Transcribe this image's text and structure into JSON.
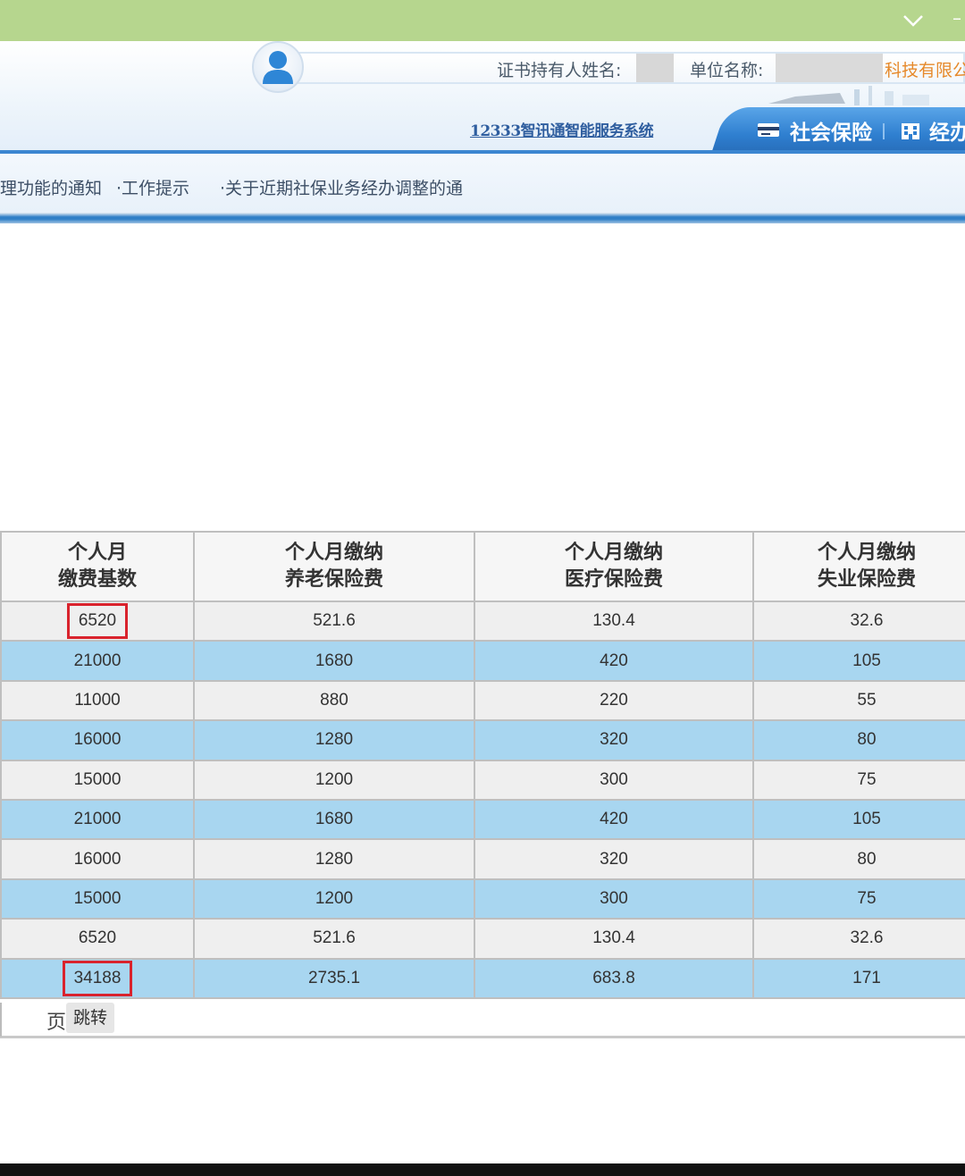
{
  "header": {
    "holder_label": "证书持有人姓名:",
    "unit_label": "单位名称:",
    "unit_name": "科技有限公",
    "system_name": "12333智讯通智能服务系统",
    "tabs": [
      "社会保险",
      "经办"
    ]
  },
  "notices": [
    "理功能的通知",
    "·工作提示",
    "·关于近期社保业务经办调整的通"
  ],
  "table": {
    "columns": [
      "个人月\n缴费基数",
      "个人月缴纳\n养老保险费",
      "个人月缴纳\n医疗保险费",
      "个人月缴纳\n失业保险费"
    ],
    "rows": [
      [
        "6520",
        "521.6",
        "130.4",
        "32.6"
      ],
      [
        "21000",
        "1680",
        "420",
        "105"
      ],
      [
        "11000",
        "880",
        "220",
        "55"
      ],
      [
        "16000",
        "1280",
        "320",
        "80"
      ],
      [
        "15000",
        "1200",
        "300",
        "75"
      ],
      [
        "21000",
        "1680",
        "420",
        "105"
      ],
      [
        "16000",
        "1280",
        "320",
        "80"
      ],
      [
        "15000",
        "1200",
        "300",
        "75"
      ],
      [
        "6520",
        "521.6",
        "130.4",
        "32.6"
      ],
      [
        "34188",
        "2735.1",
        "683.8",
        "171"
      ]
    ]
  },
  "pager": {
    "page_label": "页",
    "jump_label": "跳转"
  },
  "colors": {
    "topbar": "#b6d68e",
    "tab_blue": "#2f7fd0",
    "row_blue": "#a8d6f0",
    "row_gray": "#efefef",
    "highlight_red": "#d9232d",
    "company_orange": "#e6892a"
  },
  "icons": [
    "chevron-down-icon",
    "user-avatar-icon",
    "card-icon",
    "building-icon"
  ]
}
